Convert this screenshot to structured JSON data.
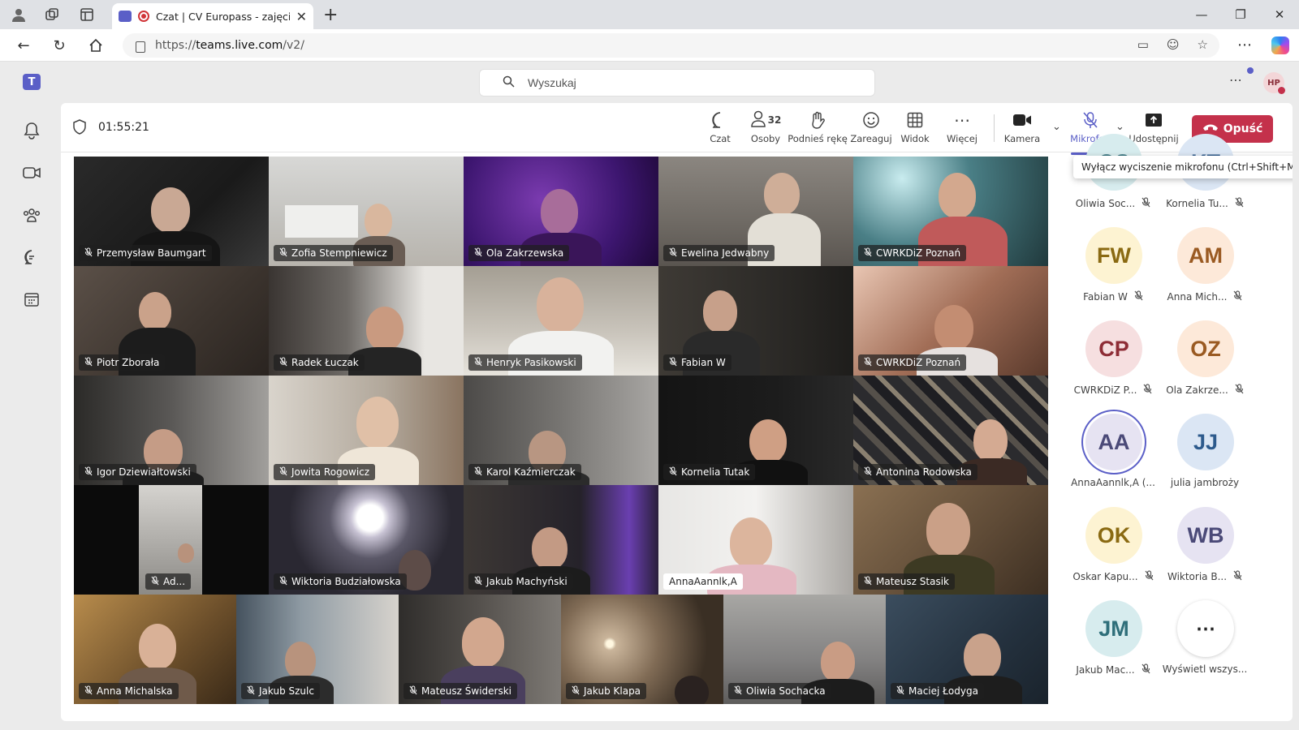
{
  "browser": {
    "tab_title": "Czat | CV Europass - zajęcia z",
    "url_prefix": "https://",
    "url_host": "teams.live.com",
    "url_path": "/v2/"
  },
  "teams": {
    "search_placeholder": "Wyszukaj",
    "user_initials": "HP"
  },
  "meeting": {
    "timer": "01:55:21",
    "people_count": "32",
    "toolbar": {
      "chat": "Czat",
      "people": "Osoby",
      "raise_hand": "Podnieś rękę",
      "react": "Zareaguj",
      "view": "Widok",
      "more": "Więcej",
      "camera": "Kamera",
      "mic": "Mikrofon",
      "share": "Udostępnij",
      "leave": "Opuść"
    },
    "tooltip": "Wyłącz wyciszenie mikrofonu (Ctrl+Shift+M)"
  },
  "video_tiles": [
    {
      "name": "Przemysław Baumgart"
    },
    {
      "name": "Zofia Stempniewicz"
    },
    {
      "name": "Ola Zakrzewska"
    },
    {
      "name": "Ewelina Jedwabny"
    },
    {
      "name": "CWRKDiZ Poznań"
    },
    {
      "name": "Piotr Zborała"
    },
    {
      "name": "Radek Łuczak"
    },
    {
      "name": "Henryk Pasikowski"
    },
    {
      "name": "Fabian W"
    },
    {
      "name": "CWRKDiZ Poznań"
    },
    {
      "name": "Igor Dziewiałtowski"
    },
    {
      "name": "Jowita Rogowicz"
    },
    {
      "name": "Karol Kaźmierczak"
    },
    {
      "name": "Kornelia Tutak"
    },
    {
      "name": "Antonina Rodowska"
    },
    {
      "name": "Ad..."
    },
    {
      "name": "Wiktoria Budziałowska"
    },
    {
      "name": "Jakub Machyński"
    },
    {
      "name": "AnnaAannlk,A"
    },
    {
      "name": "Mateusz Stasik"
    },
    {
      "name": "Anna Michalska"
    },
    {
      "name": "Jakub Szulc"
    },
    {
      "name": "Mateusz Świderski"
    },
    {
      "name": "Jakub Klapa"
    },
    {
      "name": "Oliwia Sochacka"
    },
    {
      "name": "Maciej Łodyga"
    }
  ],
  "roster": [
    {
      "initials": "OS",
      "name": "Oliwia Soc...",
      "bg": "#d7ecee",
      "fg": "#2f6f7a",
      "muted": true
    },
    {
      "initials": "KT",
      "name": "Kornelia Tu...",
      "bg": "#dbe6f4",
      "fg": "#2d5a8c",
      "muted": true
    },
    {
      "initials": "FW",
      "name": "Fabian W",
      "bg": "#fdf3d2",
      "fg": "#8a6a12",
      "muted": true
    },
    {
      "initials": "AM",
      "name": "Anna Mich...",
      "bg": "#fde9d9",
      "fg": "#9a5a22",
      "muted": true
    },
    {
      "initials": "CP",
      "name": "CWRKDiZ P...",
      "bg": "#f6dfe0",
      "fg": "#8e2d36",
      "muted": true
    },
    {
      "initials": "OZ",
      "name": "Ola Zakrze...",
      "bg": "#fde9d9",
      "fg": "#9a5a22",
      "muted": true
    },
    {
      "initials": "AA",
      "name": "AnnaAannlk,A (...",
      "bg": "#e6e3f2",
      "fg": "#4b4a78",
      "muted": false,
      "speaking": true
    },
    {
      "initials": "JJ",
      "name": "julia jambroży",
      "bg": "#dbe6f4",
      "fg": "#2d5a8c",
      "muted": false
    },
    {
      "initials": "OK",
      "name": "Oskar Kapu...",
      "bg": "#fdf3d2",
      "fg": "#8a6a12",
      "muted": true
    },
    {
      "initials": "WB",
      "name": "Wiktoria B...",
      "bg": "#e6e3f2",
      "fg": "#4b4a78",
      "muted": true
    },
    {
      "initials": "JM",
      "name": "Jakub Mac...",
      "bg": "#d7ecee",
      "fg": "#2f6f7a",
      "muted": true
    },
    {
      "initials": "⋯",
      "name": "Wyświetl wszys...",
      "bg": "#ffffff",
      "fg": "#242424",
      "muted": false,
      "more": true
    }
  ],
  "colors": {
    "accent": "#5b5fc7",
    "leave": "#c4314b"
  }
}
